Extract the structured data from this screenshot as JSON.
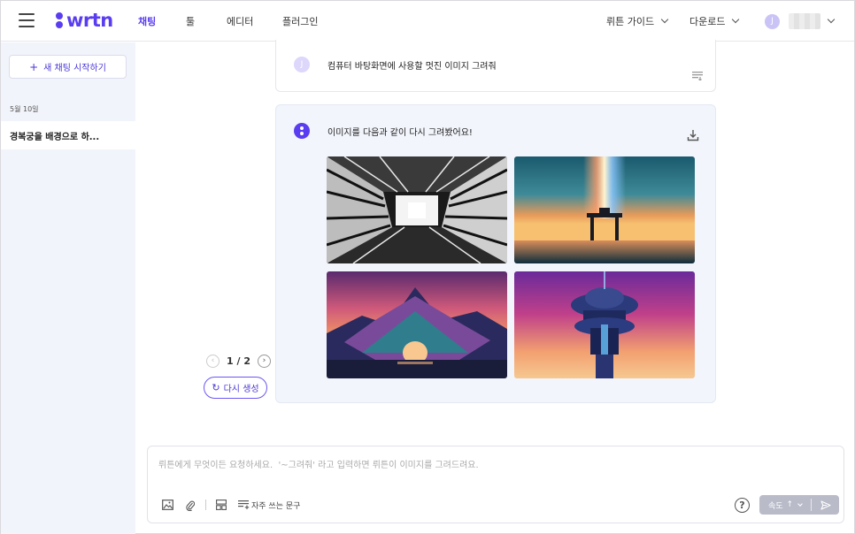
{
  "header": {
    "logo_text": "wrtn",
    "nav": [
      {
        "label": "채팅",
        "active": true
      },
      {
        "label": "툴",
        "active": false
      },
      {
        "label": "에디터",
        "active": false
      },
      {
        "label": "플러그인",
        "active": false
      }
    ],
    "guide_label": "뤼튼 가이드",
    "download_label": "다운로드",
    "user_initial": "J"
  },
  "sidebar": {
    "new_chat_label": "새 채팅 시작하기",
    "date_label": "5월 10일",
    "chats": [
      {
        "title": "경복궁을 배경으로 하..."
      }
    ]
  },
  "conversation": {
    "user_initial": "J",
    "user_message": "컴퓨터 바탕화면에 사용할 멋진 이미지 그려줘",
    "ai_message": "이미지를 다음과 같이 다시 그려봤어요!",
    "images": [
      {
        "name": "generated-image-1",
        "desc": "black and white tunnel"
      },
      {
        "name": "generated-image-2",
        "desc": "sunset sea structure"
      },
      {
        "name": "generated-image-3",
        "desc": "mountain arch sunset"
      },
      {
        "name": "generated-image-4",
        "desc": "purple tower"
      }
    ],
    "pager": "1 / 2",
    "regenerate_label": "다시 생성"
  },
  "input": {
    "placeholder": "뤼튼에게 무엇이든 요청하세요.  '~그려줘' 라고 입력하면 뤼튼이 이미지를 그려드려요.",
    "phrase_label": "자주 쓰는 문구",
    "speed_label": "속도",
    "help_label": "?"
  },
  "colors": {
    "brand": "#5a3df0",
    "sidebar_bg": "#f2f4fb",
    "ai_card_bg": "#f2f5fc",
    "send_bg": "#b9bbc9"
  }
}
